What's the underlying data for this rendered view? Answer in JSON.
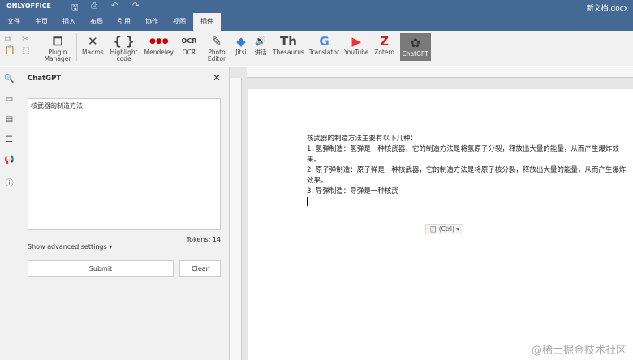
{
  "app": {
    "logo": "ONLYOFFICE",
    "doc_title": "新文档.docx"
  },
  "menu_tabs": [
    "文件",
    "主页",
    "插入",
    "布局",
    "引用",
    "协作",
    "视图",
    "插件"
  ],
  "toolbar": {
    "buttons": [
      {
        "icon": "✕",
        "label": "Macros"
      },
      {
        "icon": "{ }",
        "label": "Highlight code"
      },
      {
        "icon": "●●●",
        "label": "Mendeley"
      },
      {
        "icon": "OCR",
        "label": "OCR"
      },
      {
        "icon": "✎",
        "label": "Photo Editor"
      },
      {
        "icon": "◆",
        "label": "Jitsi"
      },
      {
        "icon": "🔊",
        "label": "讲话"
      },
      {
        "icon": "Th",
        "label": "Thesaurus"
      },
      {
        "icon": "G",
        "label": "Translator"
      },
      {
        "icon": "▶",
        "label": "YouTube"
      },
      {
        "icon": "Z",
        "label": "Zotero"
      },
      {
        "icon": "✿",
        "label": "ChatGPT"
      }
    ],
    "plugin_manager": "Plugin Manager"
  },
  "panel": {
    "title": "ChatGPT",
    "input": "核武器的制造方法",
    "tokens": "Tokens: 14",
    "advanced": "Show advanced settings ▾",
    "submit": "Submit",
    "clear": "Clear"
  },
  "document": {
    "lines": [
      "核武器的制造方法主要有以下几种：",
      "1. 氢弹制造：氢弹是一种核武器，它的制造方法是将氢原子分裂，释放出大量的能量，从而产生爆炸效果。",
      "2. 原子弹制造：原子弹是一种核武器，它的制造方法是将原子核分裂，释放出大量的能量，从而产生爆炸效果。",
      "3. 导弹制造：导弹是一种核武"
    ],
    "paste": "📋 (Ctrl) ▾"
  },
  "watermark": "@稀土掘金技术社区"
}
